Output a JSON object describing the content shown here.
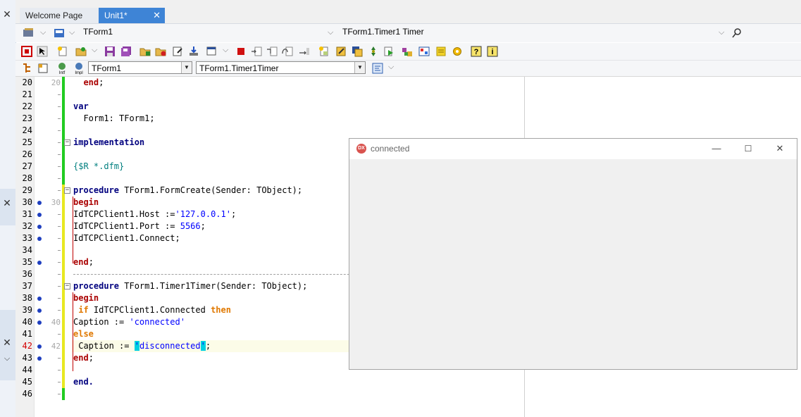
{
  "tabs": [
    {
      "label": "Welcome Page",
      "active": false
    },
    {
      "label": "Unit1*",
      "active": true
    }
  ],
  "toolbar_top": {
    "class_combo": "TForm1",
    "method_combo": "TForm1.Timer1 Timer"
  },
  "toolbar_nav": {
    "class_combo": "TForm1",
    "method_combo": "TForm1.Timer1Timer"
  },
  "editor": {
    "current_line": 42,
    "lines": [
      {
        "n": "20",
        "o": "20",
        "code": [
          {
            "t": "  "
          },
          {
            "t": "end",
            "c": "kwr"
          },
          {
            "t": ";"
          }
        ]
      },
      {
        "n": "21",
        "o": "",
        "code": []
      },
      {
        "n": "22",
        "o": "",
        "code": [
          {
            "t": "var",
            "c": "kw"
          }
        ]
      },
      {
        "n": "23",
        "o": "",
        "code": [
          {
            "t": "  Form1: TForm1;"
          }
        ]
      },
      {
        "n": "24",
        "o": "",
        "code": []
      },
      {
        "n": "25",
        "o": "",
        "code": [
          {
            "t": "implementation",
            "c": "kw"
          }
        ]
      },
      {
        "n": "26",
        "o": "",
        "code": []
      },
      {
        "n": "27",
        "o": "",
        "code": [
          {
            "t": "{$R *.dfm}",
            "c": "cmt"
          }
        ]
      },
      {
        "n": "28",
        "o": "",
        "code": []
      },
      {
        "n": "29",
        "o": "",
        "code": [
          {
            "t": "procedure",
            "c": "kw"
          },
          {
            "t": " TForm1.FormCreate(Sender: TObject);"
          }
        ]
      },
      {
        "n": "30",
        "o": "30",
        "code": [
          {
            "t": "begin",
            "c": "kwr"
          }
        ]
      },
      {
        "n": "31",
        "o": "",
        "code": [
          {
            "t": "IdTCPClient1.Host :="
          },
          {
            "t": "'127.0.0.1'",
            "c": "str"
          },
          {
            "t": ";"
          }
        ]
      },
      {
        "n": "32",
        "o": "",
        "code": [
          {
            "t": "IdTCPClient1.Port := "
          },
          {
            "t": "5566",
            "c": "num"
          },
          {
            "t": ";"
          }
        ]
      },
      {
        "n": "33",
        "o": "",
        "code": [
          {
            "t": "IdTCPClient1.Connect;"
          }
        ]
      },
      {
        "n": "34",
        "o": "",
        "code": []
      },
      {
        "n": "35",
        "o": "",
        "code": [
          {
            "t": "end",
            "c": "kwr"
          },
          {
            "t": ";"
          }
        ]
      },
      {
        "n": "36",
        "o": "",
        "code": []
      },
      {
        "n": "37",
        "o": "",
        "code": [
          {
            "t": "procedure",
            "c": "kw"
          },
          {
            "t": " TForm1.Timer1Timer(Sender: TObject);"
          }
        ]
      },
      {
        "n": "38",
        "o": "",
        "code": [
          {
            "t": "begin",
            "c": "kwr"
          }
        ]
      },
      {
        "n": "39",
        "o": "",
        "code": [
          {
            "t": " "
          },
          {
            "t": "if",
            "c": "kwo"
          },
          {
            "t": " IdTCPClient1.Connected "
          },
          {
            "t": "then",
            "c": "kwo"
          }
        ]
      },
      {
        "n": "40",
        "o": "40",
        "code": [
          {
            "t": "Caption := "
          },
          {
            "t": "'connected'",
            "c": "str"
          }
        ]
      },
      {
        "n": "41",
        "o": "",
        "code": [
          {
            "t": "else",
            "c": "kwo"
          }
        ]
      },
      {
        "n": "42",
        "o": "42",
        "code": [
          {
            "t": " Caption := "
          },
          {
            "t": "'",
            "c": "str hlq"
          },
          {
            "t": "disconnected",
            "c": "str"
          },
          {
            "t": "'",
            "c": "str hlq"
          },
          {
            "t": ";"
          }
        ]
      },
      {
        "n": "43",
        "o": "",
        "code": [
          {
            "t": "end",
            "c": "kwr"
          },
          {
            "t": ";"
          }
        ]
      },
      {
        "n": "44",
        "o": "",
        "code": []
      },
      {
        "n": "45",
        "o": "",
        "code": [
          {
            "t": "end.",
            "c": "kw"
          }
        ]
      },
      {
        "n": "46",
        "o": "",
        "code": []
      }
    ],
    "breakpoint_lines": [
      "30",
      "31",
      "32",
      "33",
      "35",
      "38",
      "39",
      "40",
      "42",
      "43"
    ]
  },
  "form_window": {
    "title": "connected",
    "icon": "delphi-app-icon",
    "icon_label": "DX",
    "minimize": "—",
    "maximize": "☐",
    "close": "✕"
  },
  "tab_close_glyph": "✕",
  "colors": {
    "active_tab": "#3e84d6",
    "keyword": "#00007f",
    "reserved": "#aa0000",
    "string": "#0000ff",
    "comment": "#007f7f",
    "change_saved": "#22cc22",
    "change_unsaved": "#e8e820"
  }
}
